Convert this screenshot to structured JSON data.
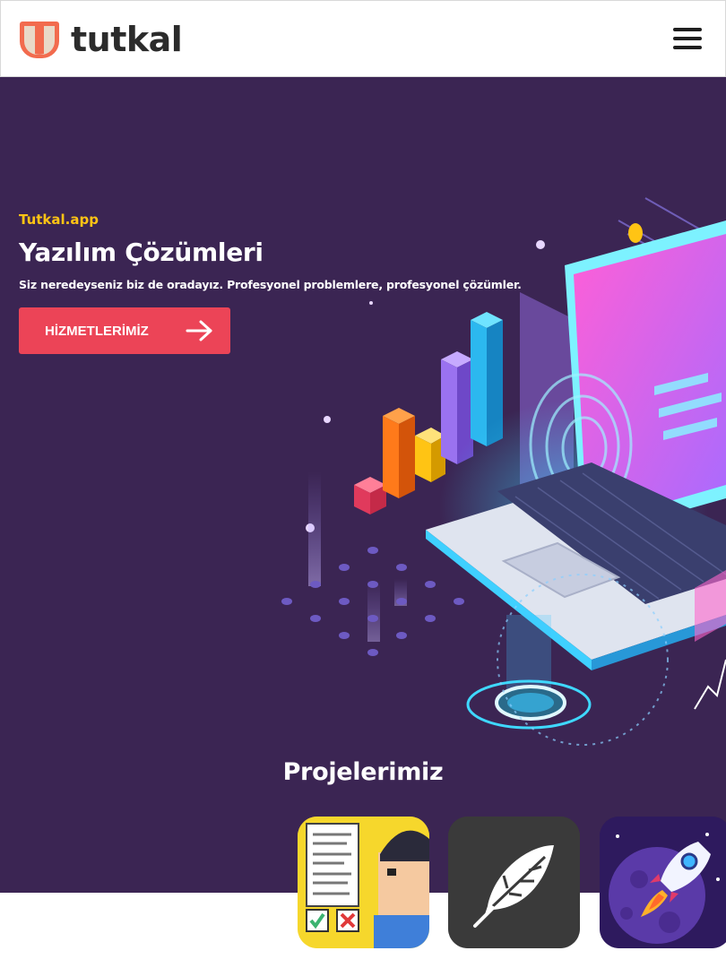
{
  "header": {
    "logo_text": "tutkal",
    "menu_icon": "hamburger-menu-icon"
  },
  "hero": {
    "eyebrow": "Tutkal.app",
    "title": "Yazılım Çözümleri",
    "subtitle": "Siz neredeyseniz biz de oradayız. Profesyonel problemlere, profesyonel çözümler.",
    "cta_label": "HİZMETLERİMİZ",
    "cta_icon": "arrow-right-icon",
    "background": "#3b2553",
    "accent": "#ffc414",
    "cta_color": "#ec4457"
  },
  "projects": {
    "title": "Projelerimiz",
    "items": [
      {
        "icon": "checklist-app-icon"
      },
      {
        "icon": "feather-app-icon"
      },
      {
        "icon": "rocket-planet-app-icon"
      }
    ]
  }
}
